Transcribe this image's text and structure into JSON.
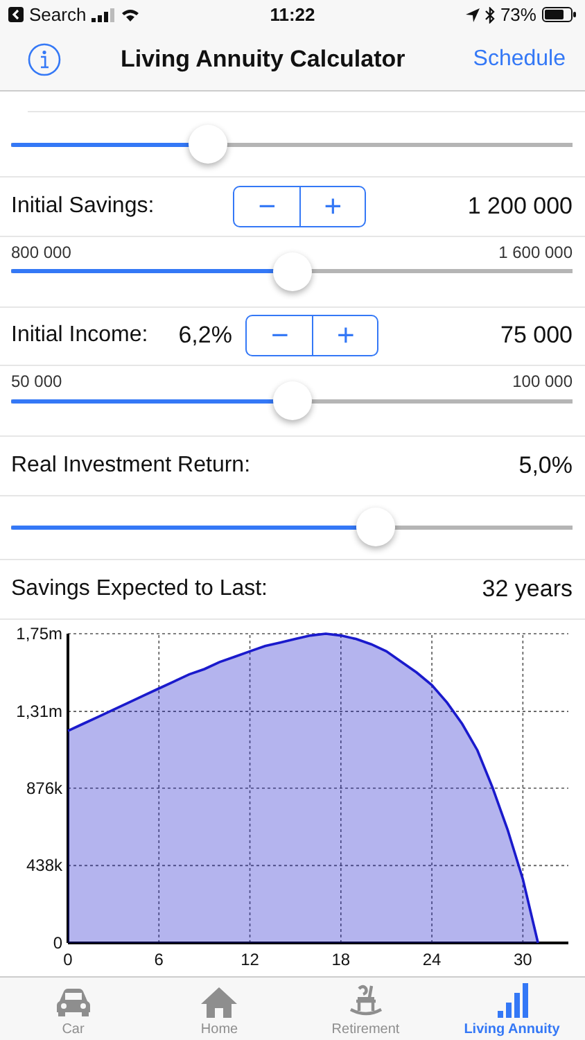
{
  "status_bar": {
    "back_label": "Search",
    "time": "11:22",
    "battery": "73%"
  },
  "nav": {
    "title": "Living Annuity Calculator",
    "action": "Schedule"
  },
  "inputs": [
    {
      "kind": "slider",
      "level": 0.35
    },
    {
      "kind": "stepper",
      "label": "Initial Savings:",
      "value": "1 200 000",
      "minus": "−",
      "plus": "+",
      "min": "800 000",
      "max": "1 600 000",
      "level": 0.5
    },
    {
      "kind": "stepper",
      "label": "Initial Income:",
      "percent": "6,2%",
      "value": "75 000",
      "minus": "−",
      "plus": "+",
      "min": "50 000",
      "max": "100 000",
      "level": 0.5
    },
    {
      "kind": "plain",
      "label": "Real Investment Return:",
      "value": "5,0%",
      "level": 0.65
    }
  ],
  "result": {
    "label": "Savings Expected to Last:",
    "value": "32 years"
  },
  "chart": {
    "chart_data": {
      "type": "area",
      "grid": true,
      "xlim": [
        0,
        33
      ],
      "ylim": [
        0,
        1750000
      ],
      "xticks": [
        0,
        6,
        12,
        18,
        24,
        30
      ],
      "yticks": [
        {
          "value": 0,
          "label": "0"
        },
        {
          "value": 438000,
          "label": "438k"
        },
        {
          "value": 876000,
          "label": "876k"
        },
        {
          "value": 1310000,
          "label": "1,31m"
        },
        {
          "value": 1750000,
          "label": "1,75m"
        }
      ],
      "x": [
        0,
        1,
        2,
        3,
        4,
        5,
        6,
        7,
        8,
        9,
        10,
        11,
        12,
        13,
        14,
        15,
        16,
        17,
        18,
        19,
        20,
        21,
        22,
        23,
        24,
        25,
        26,
        27,
        28,
        29,
        30,
        31
      ],
      "series": [
        {
          "color": "#1a1acc",
          "values": [
            1200000,
            1240000,
            1280000,
            1320000,
            1360000,
            1400000,
            1440000,
            1480000,
            1520000,
            1550000,
            1590000,
            1620000,
            1650000,
            1680000,
            1700000,
            1720000,
            1740000,
            1750000,
            1740000,
            1720000,
            1690000,
            1650000,
            1590000,
            1530000,
            1460000,
            1360000,
            1240000,
            1090000,
            880000,
            640000,
            360000,
            0
          ]
        }
      ]
    }
  },
  "tabs": [
    {
      "label": "Car",
      "selected": false
    },
    {
      "label": "Home",
      "selected": false
    },
    {
      "label": "Retirement",
      "selected": false
    },
    {
      "label": "Living Annuity",
      "selected": true
    }
  ]
}
